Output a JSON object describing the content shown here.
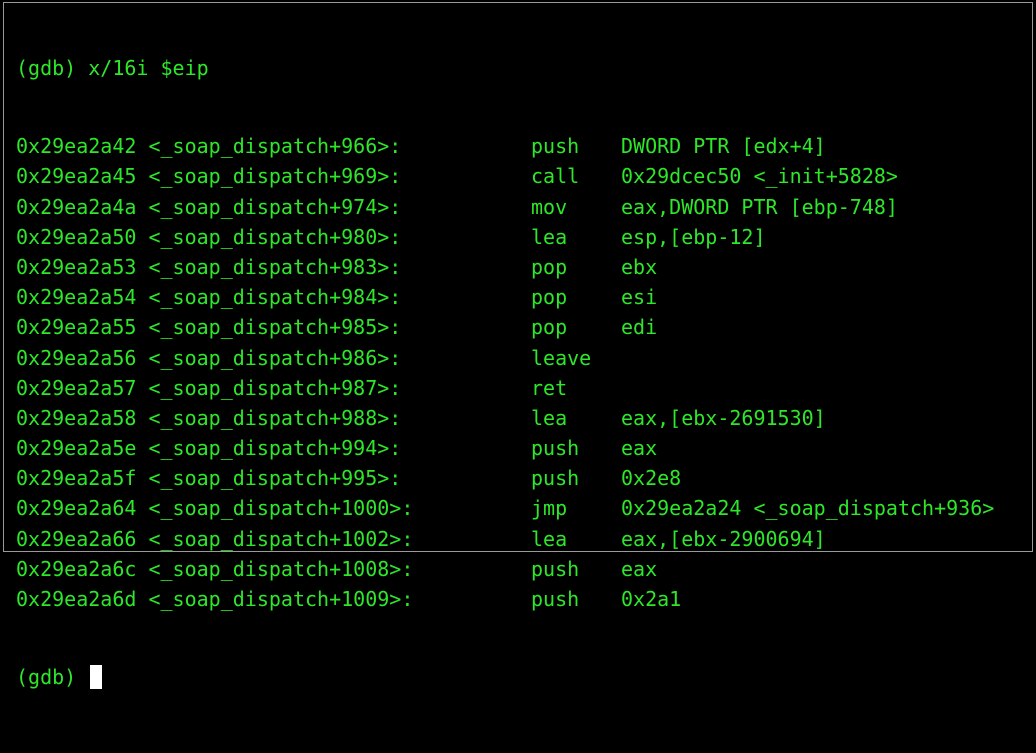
{
  "terminal": {
    "command_line": "(gdb) x/16i $eip",
    "instructions": [
      {
        "addr": "0x29ea2a42 <_soap_dispatch+966>:",
        "mnemonic": "push",
        "operands": "DWORD PTR [edx+4]"
      },
      {
        "addr": "0x29ea2a45 <_soap_dispatch+969>:",
        "mnemonic": "call",
        "operands": "0x29dcec50 <_init+5828>"
      },
      {
        "addr": "0x29ea2a4a <_soap_dispatch+974>:",
        "mnemonic": "mov",
        "operands": "eax,DWORD PTR [ebp-748]"
      },
      {
        "addr": "0x29ea2a50 <_soap_dispatch+980>:",
        "mnemonic": "lea",
        "operands": "esp,[ebp-12]"
      },
      {
        "addr": "0x29ea2a53 <_soap_dispatch+983>:",
        "mnemonic": "pop",
        "operands": "ebx"
      },
      {
        "addr": "0x29ea2a54 <_soap_dispatch+984>:",
        "mnemonic": "pop",
        "operands": "esi"
      },
      {
        "addr": "0x29ea2a55 <_soap_dispatch+985>:",
        "mnemonic": "pop",
        "operands": "edi"
      },
      {
        "addr": "0x29ea2a56 <_soap_dispatch+986>:",
        "mnemonic": "leave",
        "operands": ""
      },
      {
        "addr": "0x29ea2a57 <_soap_dispatch+987>:",
        "mnemonic": "ret",
        "operands": ""
      },
      {
        "addr": "0x29ea2a58 <_soap_dispatch+988>:",
        "mnemonic": "lea",
        "operands": "eax,[ebx-2691530]"
      },
      {
        "addr": "0x29ea2a5e <_soap_dispatch+994>:",
        "mnemonic": "push",
        "operands": "eax"
      },
      {
        "addr": "0x29ea2a5f <_soap_dispatch+995>:",
        "mnemonic": "push",
        "operands": "0x2e8"
      },
      {
        "addr": "0x29ea2a64 <_soap_dispatch+1000>:",
        "mnemonic": "jmp",
        "operands": "0x29ea2a24 <_soap_dispatch+936>"
      },
      {
        "addr": "0x29ea2a66 <_soap_dispatch+1002>:",
        "mnemonic": "lea",
        "operands": "eax,[ebx-2900694]"
      },
      {
        "addr": "0x29ea2a6c <_soap_dispatch+1008>:",
        "mnemonic": "push",
        "operands": "eax"
      },
      {
        "addr": "0x29ea2a6d <_soap_dispatch+1009>:",
        "mnemonic": "push",
        "operands": "0x2a1"
      }
    ],
    "prompt": "(gdb) ",
    "text_color": "#2ee62a",
    "background_color": "#000000",
    "cursor_color": "#ffffff"
  }
}
